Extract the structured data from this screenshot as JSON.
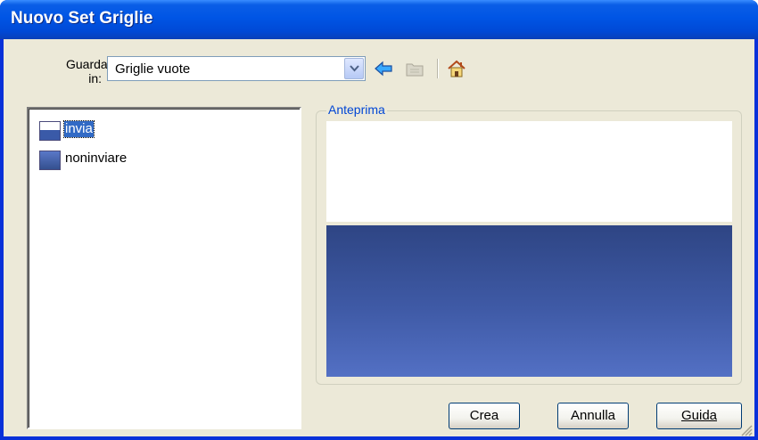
{
  "window": {
    "title": "Nuovo Set Griglie"
  },
  "toolbar": {
    "look_in_label": "Guarda in:",
    "look_in_value": "Griglie vuote",
    "icons": [
      "back-arrow-icon",
      "up-folder-icon",
      "home-icon"
    ]
  },
  "list": {
    "items": [
      {
        "label": "invia",
        "selected": true
      },
      {
        "label": "noninviare",
        "selected": false
      }
    ]
  },
  "preview": {
    "label": "Anteprima"
  },
  "buttons": {
    "create": "Crea",
    "cancel": "Annulla",
    "help": "Guida"
  },
  "colors": {
    "titlebar": "#0055e5",
    "selection": "#316ac5",
    "preview_dark": "#3f5aa6",
    "legend": "#0046d5"
  }
}
